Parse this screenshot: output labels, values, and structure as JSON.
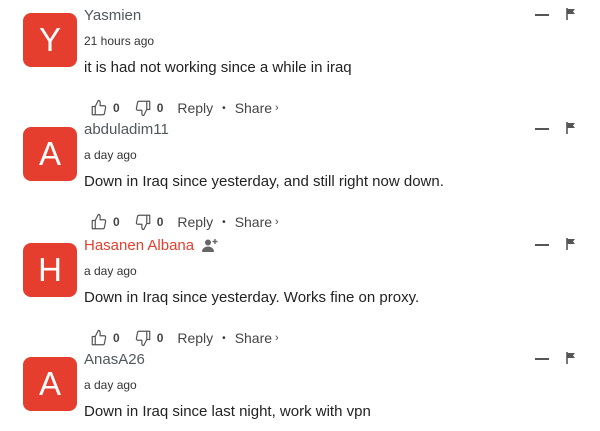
{
  "comments": [
    {
      "avatar_letter": "Y",
      "avatar_color": "#e53e2f",
      "author": "Yasmien",
      "author_highlight": false,
      "time": "21 hours ago",
      "text": "it is had not working since a while in iraq",
      "upvotes": "0",
      "downvotes": "0",
      "reply_label": "Reply",
      "share_label": "Share",
      "share_chevron": "›"
    },
    {
      "avatar_letter": "A",
      "avatar_color": "#e53e2f",
      "author": "abduladim11",
      "author_highlight": false,
      "time": "a day ago",
      "text": "Down in Iraq since yesterday, and still right now down.",
      "upvotes": "0",
      "downvotes": "0",
      "reply_label": "Reply",
      "share_label": "Share",
      "share_chevron": "›"
    },
    {
      "avatar_letter": "H",
      "avatar_color": "#e53e2f",
      "author": "Hasanen Albana",
      "author_highlight": true,
      "time": "a day ago",
      "text": "Down in Iraq since yesterday. Works fine on proxy.",
      "upvotes": "0",
      "downvotes": "0",
      "reply_label": "Reply",
      "share_label": "Share",
      "share_chevron": "›"
    },
    {
      "avatar_letter": "A",
      "avatar_color": "#e53e2f",
      "author": "AnasA26",
      "author_highlight": false,
      "time": "a day ago",
      "text": "Down in Iraq since last night, work with vpn"
    }
  ],
  "separator": "•",
  "icons": {
    "upvote": "thumbs-up-icon",
    "downvote": "thumbs-down-icon",
    "collapse": "minus-icon",
    "flag": "flag-icon",
    "follow": "follow-user-icon"
  }
}
